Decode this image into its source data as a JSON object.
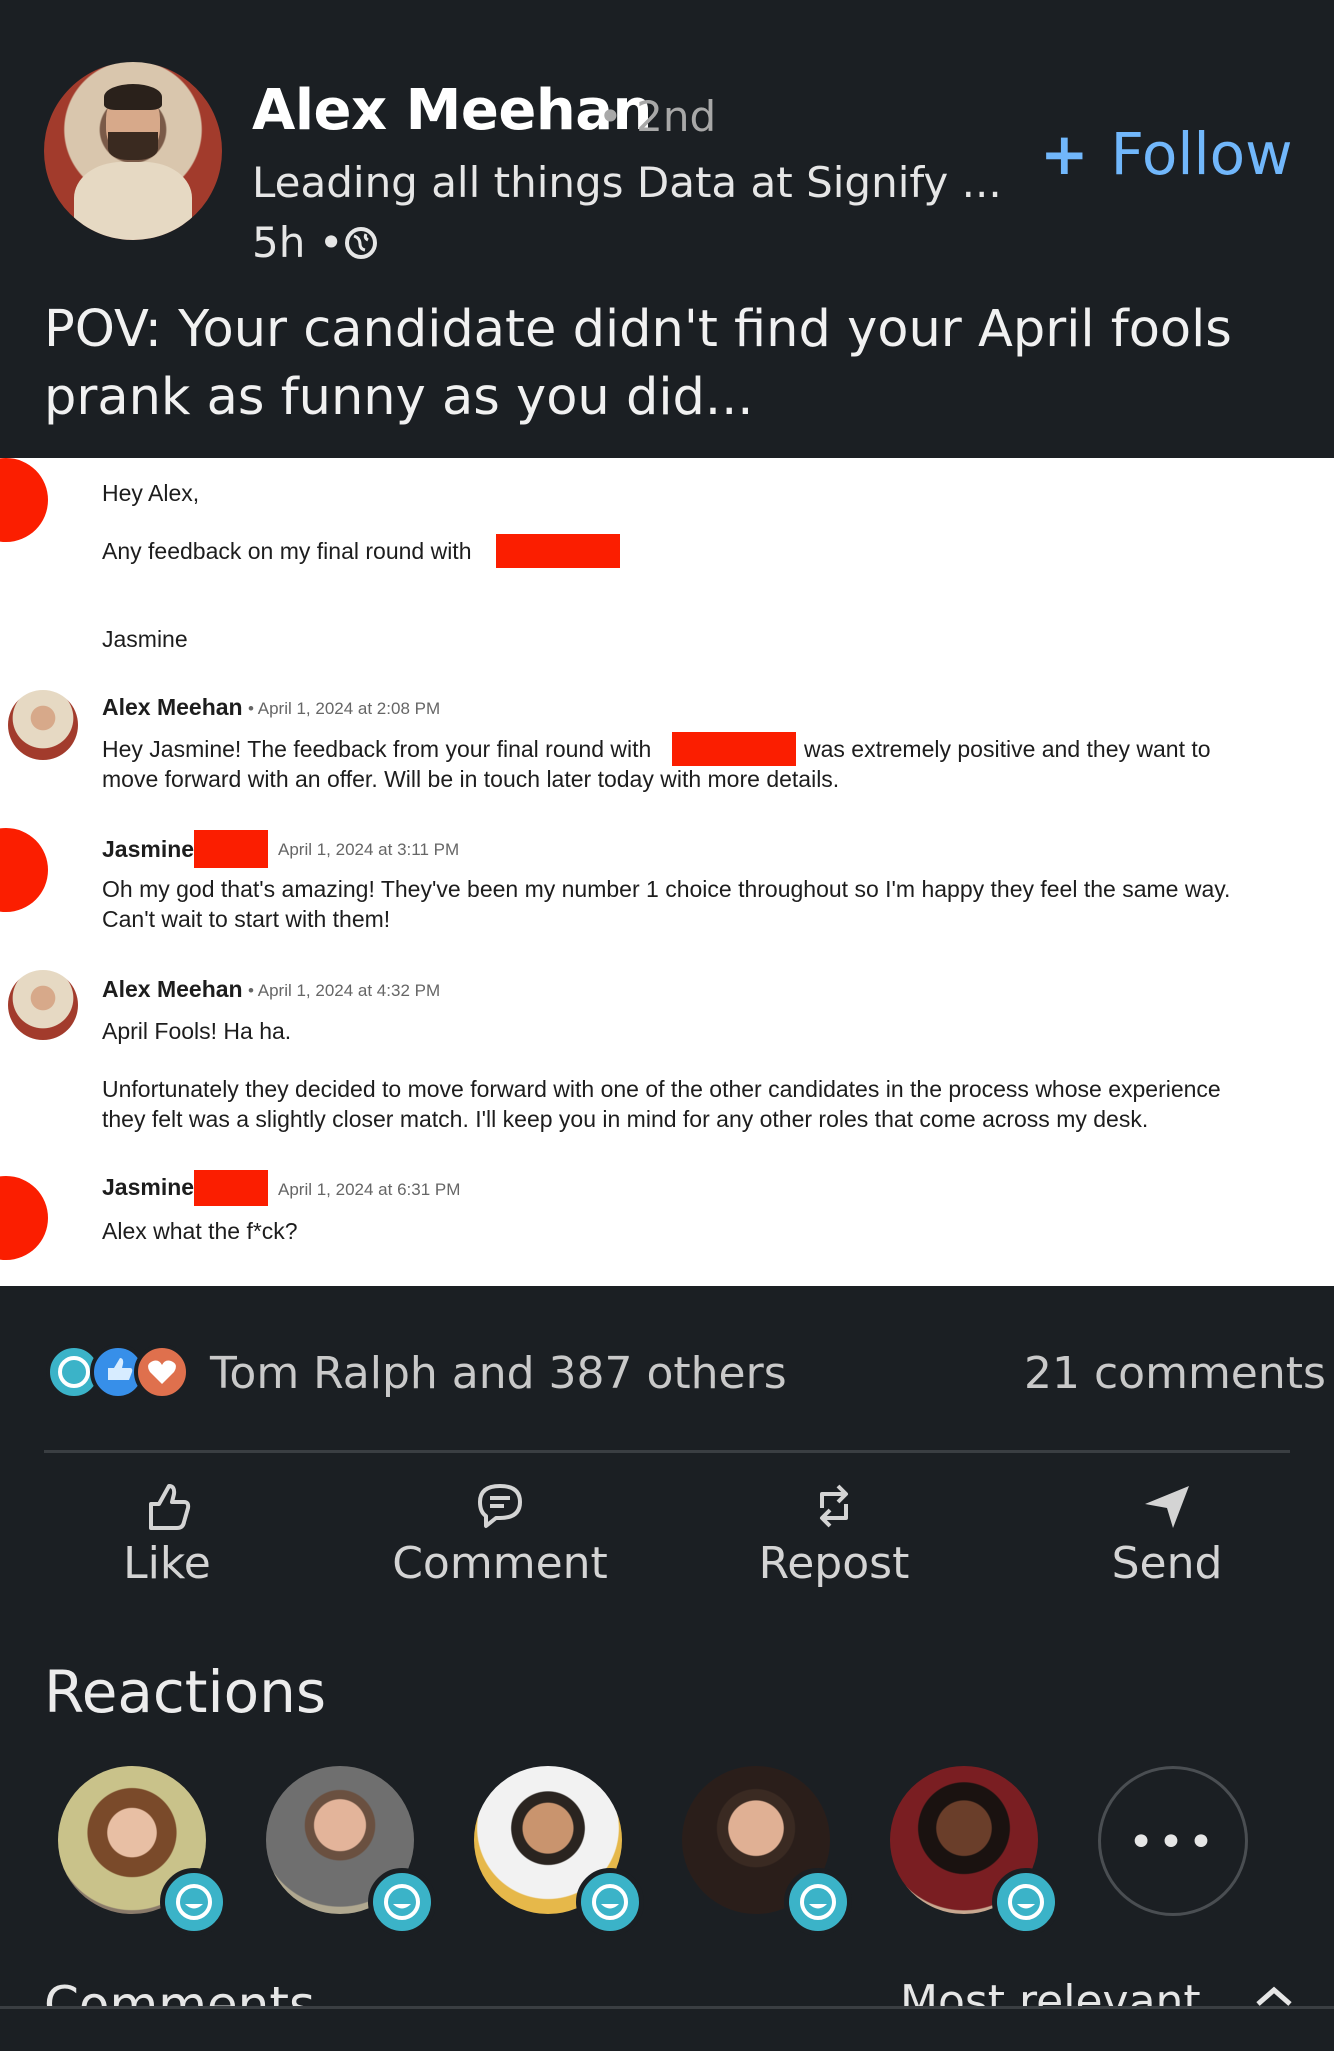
{
  "post": {
    "author_name": "Alex Meehan",
    "author_degree": "• 2nd",
    "author_headline": "Leading all things Data at Signify ...",
    "time": "5h •",
    "follow_label": "Follow",
    "text": "POV: Your candidate didn't find your April fools prank as funny as you did..."
  },
  "screenshot": {
    "msg1_greeting": "Hey Alex,",
    "msg1_body": "Any feedback on my final round with",
    "msg1_sign": "Jasmine",
    "m2_name": "Alex Meehan",
    "m2_time": "• April 1, 2024 at 2:08 PM",
    "m2_line1a": "Hey Jasmine! The feedback from your final round with",
    "m2_line1b": "was extremely positive and they want to",
    "m2_line2": "move forward with an offer. Will be in touch later today with more details.",
    "m3_name": "Jasmine",
    "m3_time": "April 1, 2024 at 3:11 PM",
    "m3_line1": "Oh my god that's amazing! They've been my number 1 choice throughout so I'm happy they feel the same way.",
    "m3_line2": "Can't wait to start with them!",
    "m4_name": "Alex Meehan",
    "m4_time": "• April 1, 2024 at 4:32 PM",
    "m4_line1": "April Fools! Ha ha.",
    "m4_line2": "Unfortunately they decided to move forward with one of the other candidates in the process whose experience",
    "m4_line3": "they felt was a slightly closer match. I'll keep you in mind for any other roles that come across my desk.",
    "m5_name": "Jasmine",
    "m5_time": "April 1, 2024 at 6:31 PM",
    "m5_line1": "Alex what the f*ck?"
  },
  "social": {
    "reactions_summary": "Tom Ralph and 387 others",
    "comment_count": "21 comments"
  },
  "actions": {
    "like": "Like",
    "comment": "Comment",
    "repost": "Repost",
    "send": "Send"
  },
  "reactions_section": {
    "title": "Reactions",
    "more": "•••"
  },
  "comments_section": {
    "title": "Comments",
    "sort": "Most relevant"
  },
  "colors": {
    "background": "#1b1f23",
    "accent": "#71b7fb",
    "redaction": "#fb1e00"
  }
}
